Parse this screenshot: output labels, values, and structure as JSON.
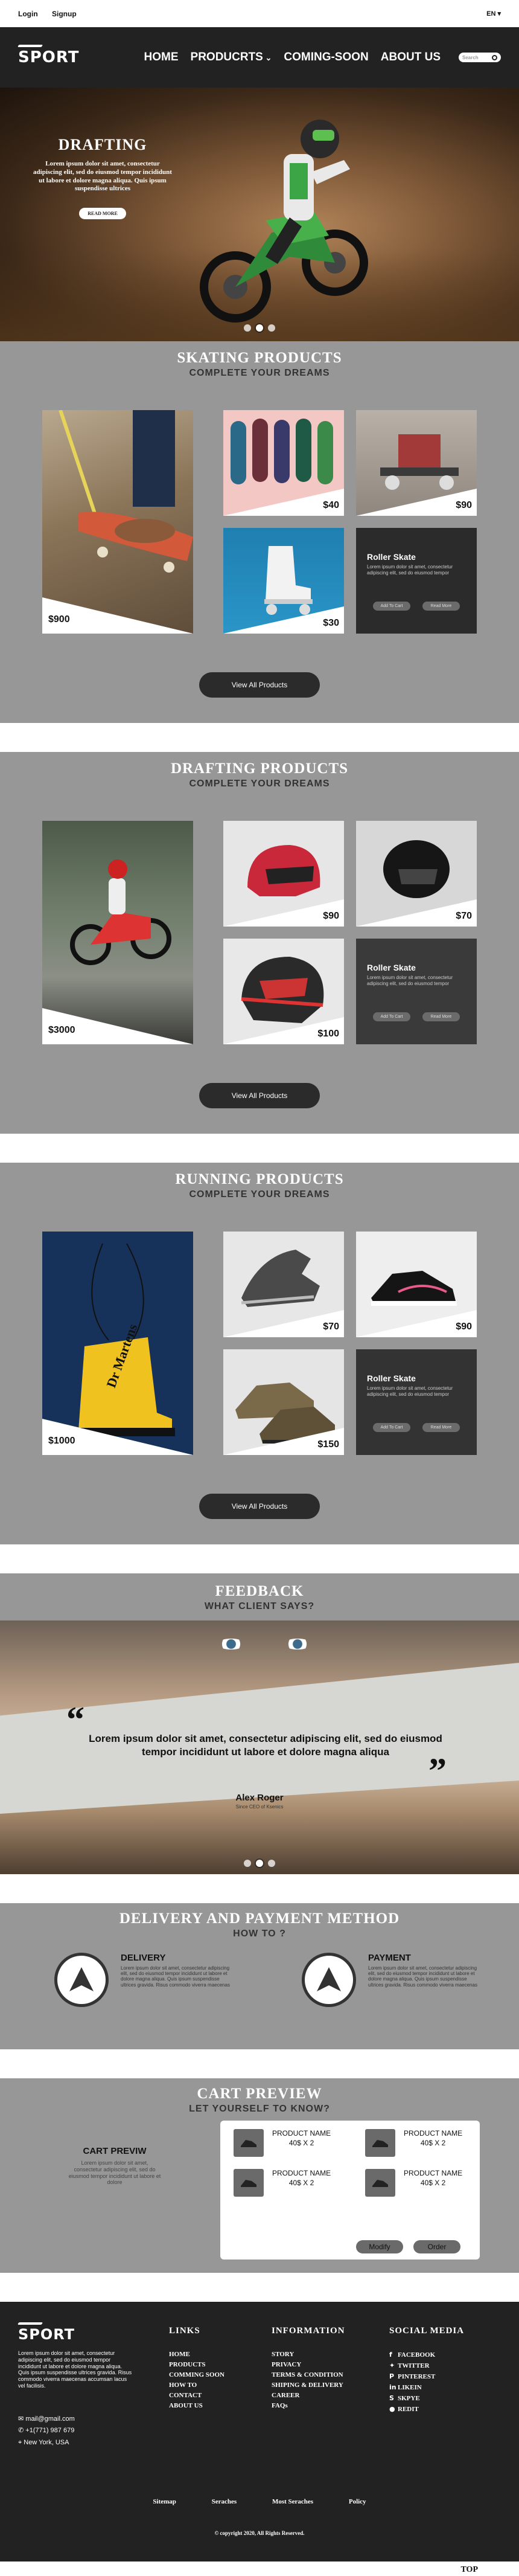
{
  "topbar": {
    "login": "Login",
    "signup": "Signup",
    "lang": "EN"
  },
  "nav": {
    "logo": "SPORT",
    "home": "HOME",
    "products": "PRODUCRTS",
    "coming_soon": "COMING-SOON",
    "about": "ABOUT US",
    "search_placeholder": "Search"
  },
  "hero": {
    "title": "DRAFTING",
    "text": "Lorem ipsum dolor sit amet, consectetur adipiscing elit, sed do eiusmod tempor incididunt ut labore et dolore magna aliqua. Quis ipsum suspendisse ultrices",
    "button": "READ MORE"
  },
  "skating": {
    "title": "SKATING PRODUCTS",
    "subtitle": "COMPLETE YOUR DREAMS",
    "big_price": "$900",
    "p1": "$40",
    "p2": "$90",
    "p3": "$30",
    "promo_title": "Roller Skate",
    "promo_text": "Lorem ipsum dolor sit amet, consectetur adipiscing elit, sed do eiusmod tempor",
    "promo_b1": "Add To Cart",
    "promo_b2": "Read More",
    "view_all": "View All Products"
  },
  "drafting": {
    "title": "DRAFTING PRODUCTS",
    "subtitle": "COMPLETE YOUR DREAMS",
    "big_price": "$3000",
    "p1": "$90",
    "p2": "$70",
    "p3": "$100",
    "promo_title": "Roller Skate",
    "promo_text": "Lorem ipsum dolor sit amet, consectetur adipiscing elit, sed do eiusmod tempor",
    "promo_b1": "Add To Cart",
    "promo_b2": "Read More",
    "view_all": "View All Products"
  },
  "running": {
    "title": "RUNNING PRODUCTS",
    "subtitle": "COMPLETE YOUR DREAMS",
    "big_price": "$1000",
    "p1": "$70",
    "p2": "$90",
    "p3": "$150",
    "promo_title": "Roller Skate",
    "promo_text": "Lorem ipsum dolor sit amet, consectetur adipiscing elit, sed do eiusmod tempor",
    "promo_b1": "Add To Cart",
    "promo_b2": "Read More",
    "view_all": "View All Products"
  },
  "feedback": {
    "title": "FEEDBACK",
    "subtitle": "WHAT CLIENT SAYS?",
    "quote": "Lorem ipsum dolor sit amet, consectetur adipiscing elit, sed do eiusmod tempor incididunt ut labore et dolore magna aliqua",
    "name": "Alex Roger",
    "role": "Since CEO of Ksenics"
  },
  "delivery": {
    "title": "DELIVERY AND PAYMENT METHOD",
    "subtitle": "HOW TO ?",
    "d_title": "DELIVERY",
    "d_text": "Lorem ipsum dolor sit amet, consectetur adipiscing elit, sed do eiusmod tempor incididunt ut labore et dolore magna aliqua. Quis ipsum suspendisse ultrices gravida. Risus commodo viverra maecenas",
    "p_title": "PAYMENT",
    "p_text": "Lorem ipsum dolor sit amet, consectetur adipiscing elit, sed do eiusmod tempor incididunt ut labore et dolore magna aliqua. Quis ipsum suspendisse ultrices gravida. Risus commodo viverra maecenas"
  },
  "cart": {
    "title": "CART PREVIEW",
    "subtitle": "LET YOURSELF TO KNOW?",
    "left_title": "CART PREVIW",
    "left_text": "Lorem ipsum dolor sit amet, consectetur adipiscing elit, sed do eiusmod tempor incididunt ut labore et dolore",
    "items": [
      {
        "name": "PRODUCT NAME",
        "qty": "40$ X 2"
      },
      {
        "name": "PRODUCT NAME",
        "qty": "40$ X 2"
      },
      {
        "name": "PRODUCT NAME",
        "qty": "40$ X 2"
      },
      {
        "name": "PRODUCT NAME",
        "qty": "40$ X 2"
      }
    ],
    "modify": "Modify",
    "order": "Order"
  },
  "footer": {
    "logo": "SPORT",
    "about": "Lorem ipsum dolor sit amet, consectetur adipiscing elit, sed do eiusmod tempor incididunt ut labore et dolore magna aliqua. Quis ipsum suspendisse ultrices gravida. Risus commodo viverra maecenas accumsan lacus vel facilisis.",
    "email": "mail@gmail.com",
    "phone": "+1(771) 987 679",
    "address": "New York, USA",
    "links_title": "LINKS",
    "links": [
      "HOME",
      "PRODUCTS",
      "COMMING SOON",
      "HOW TO",
      "CONTACT",
      "ABOUT US"
    ],
    "info_title": "INFORMATION",
    "info": [
      "STORY",
      "PRIVACY",
      "TERMS & CONDITION",
      "SHIPING & DELIVERY",
      "CAREER",
      "FAQs"
    ],
    "social_title": "SOCIAL MEDIA",
    "social": [
      "FACEBOOK",
      "TWITTER",
      "PINTEREST",
      "LIKEIN",
      "SKPYE",
      "REDIT"
    ],
    "bar": [
      "Sitemap",
      "Seraches",
      "Most Seraches",
      "Policy"
    ],
    "copyright": "© copyright 2020, All Rights Reserved.",
    "top": "TOP"
  }
}
